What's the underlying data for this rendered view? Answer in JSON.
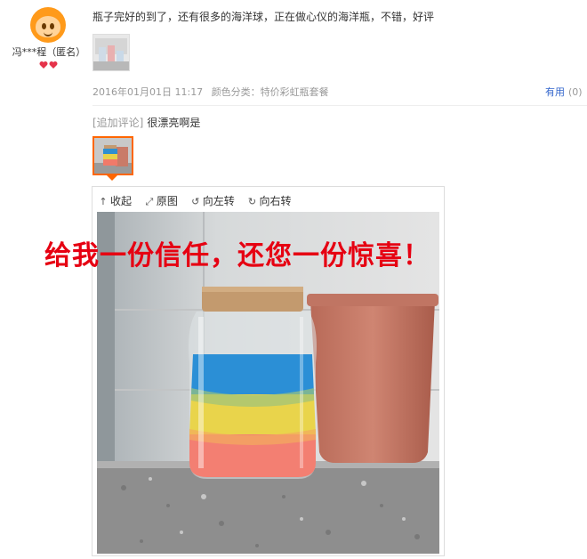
{
  "review": {
    "username": "冯***程（匿名）",
    "text": "瓶子完好的到了，还有很多的海洋球，正在做心仪的海洋瓶，不错，好评",
    "date": "2016年01月01日 11:17",
    "category_label": "颜色分类：特价彩虹瓶套餐",
    "useful_label": "有用",
    "useful_count": "(0)"
  },
  "append": {
    "tag": "[追加评论]",
    "text": "很漂亮啊是"
  },
  "viewer": {
    "toolbar": {
      "collapse": "收起",
      "original": "原图",
      "rotate_left": "向左转",
      "rotate_right": "向右转"
    }
  },
  "banner_text": "给我一份信任，还您一份惊喜！"
}
